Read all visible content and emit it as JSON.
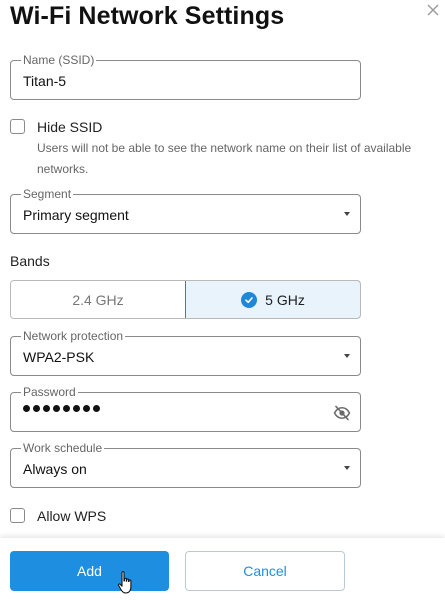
{
  "title": "Wi-Fi Network Settings",
  "ssid": {
    "legend": "Name (SSID)",
    "value": "Titan-5"
  },
  "hide_ssid": {
    "label": "Hide SSID",
    "checked": false,
    "helper": "Users will not be able to see the network name on their list of available networks."
  },
  "segment": {
    "legend": "Segment",
    "value": "Primary segment"
  },
  "bands": {
    "label": "Bands",
    "options": [
      {
        "label": "2.4 GHz",
        "selected": false
      },
      {
        "label": "5 GHz",
        "selected": true
      }
    ]
  },
  "protection": {
    "legend": "Network protection",
    "value": "WPA2-PSK"
  },
  "password": {
    "legend": "Password",
    "masked_length": 8,
    "icon": "eye-off-icon"
  },
  "schedule": {
    "legend": "Work schedule",
    "value": "Always on"
  },
  "wps": {
    "label": "Allow WPS",
    "checked": false
  },
  "footer": {
    "add_label": "Add",
    "cancel_label": "Cancel"
  },
  "colors": {
    "accent": "#1e8fe0",
    "band_selected_bg": "#e8f3fc",
    "border": "#8a8a8a"
  }
}
